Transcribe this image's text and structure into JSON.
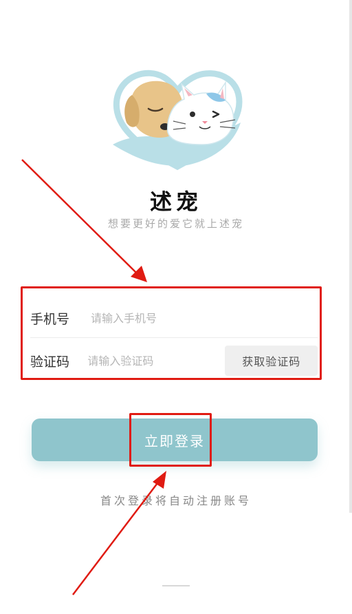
{
  "app": {
    "name": "述宠",
    "slogan": "想要更好的爱它就上述宠"
  },
  "form": {
    "phone_label": "手机号",
    "phone_placeholder": "请输入手机号",
    "phone_value": "",
    "code_label": "验证码",
    "code_placeholder": "请输入验证码",
    "code_value": "",
    "get_code_label": "获取验证码"
  },
  "login": {
    "button_label": "立即登录",
    "hint": "首次登录将自动注册账号"
  },
  "colors": {
    "primary": "#8fc5cc",
    "highlight": "#e01b12",
    "logo_blue": "#b9dfe7",
    "dog": "#e8c489",
    "cat": "#ffffff",
    "cat_patch": "#8ec7e8"
  },
  "icons": {
    "logo": "dog-and-cat-heart-logo"
  }
}
